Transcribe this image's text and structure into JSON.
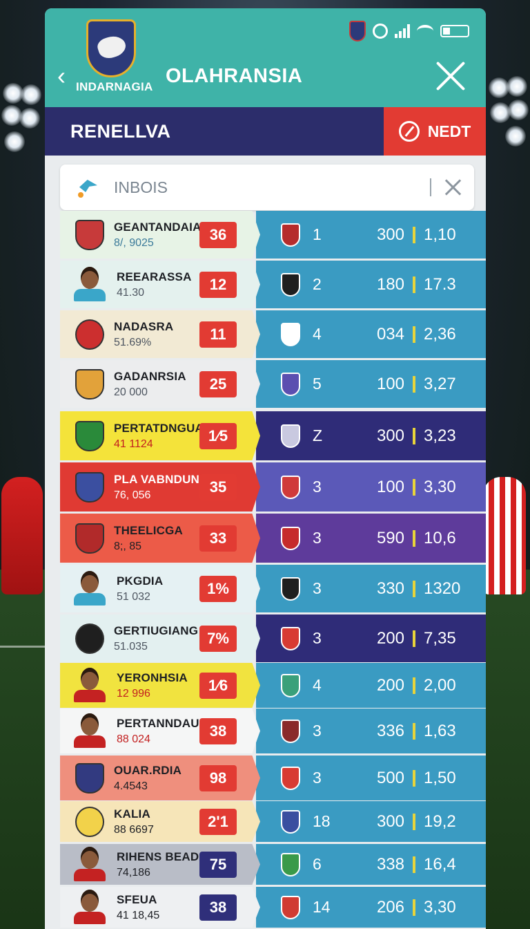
{
  "header": {
    "brand_sub": "INDARNAGIA",
    "title": "OLAHRANSIA"
  },
  "subbar": {
    "title": "RENELLVA",
    "next_label": "NEDT"
  },
  "search": {
    "placeholder": "INBOIS"
  },
  "colors": {
    "teal": "#3fb3a8",
    "navy": "#2c2d6b",
    "red": "#e23b33",
    "blue": "#3a9bc2",
    "yellow": "#f5e43a"
  },
  "rows": [
    {
      "name": "GEANTANDAIA",
      "sub": "8/, 9025",
      "badge": "36",
      "pos": "1",
      "pts": "300",
      "ratio": "1,10",
      "icon": "crest-icon"
    },
    {
      "name": "REEARASSA",
      "sub": "41.30",
      "badge": "12",
      "pos": "2",
      "pts": "180",
      "ratio": "17.3",
      "icon": "player-avatar"
    },
    {
      "name": "NADASRA",
      "sub": "51.69%",
      "badge": "11",
      "pos": "4",
      "pts": "034",
      "ratio": "2,36",
      "icon": "crest-icon"
    },
    {
      "name": "GADANRSIA",
      "sub": "20 000",
      "badge": "25",
      "pos": "5",
      "pts": "100",
      "ratio": "3,27",
      "icon": "crest-icon"
    },
    {
      "name": "PERTATDNGUA",
      "sub": "41 1124",
      "badge": "1⁄5",
      "pos": "Z",
      "pts": "300",
      "ratio": "3,23",
      "icon": "crest-icon"
    },
    {
      "name": "PLA VABNDUN",
      "sub": "76, 056",
      "badge": "35",
      "pos": "3",
      "pts": "100",
      "ratio": "3,30",
      "icon": "crest-icon"
    },
    {
      "name": "THEELICGA",
      "sub": "8;, 85",
      "badge": "33",
      "pos": "3",
      "pts": "590",
      "ratio": "10,6",
      "icon": "crest-icon"
    },
    {
      "name": "PKGDIA",
      "sub": "51 032",
      "badge": "1%",
      "pos": "3",
      "pts": "330",
      "ratio": "1320",
      "icon": "player-avatar"
    },
    {
      "name": "GERTIUGIANG",
      "sub": "51.035",
      "badge": "7%",
      "pos": "3",
      "pts": "200",
      "ratio": "7,35",
      "icon": "crest-icon"
    },
    {
      "name": "YERONHSIA",
      "sub": "12 996",
      "badge": "1⁄6",
      "pos": "4",
      "pts": "200",
      "ratio": "2,00",
      "icon": "player-avatar"
    },
    {
      "name": "PERTANNDAUK",
      "sub": "88 024",
      "badge": "38",
      "pos": "3",
      "pts": "336",
      "ratio": "1,63",
      "icon": "player-avatar"
    },
    {
      "name": "OUAR.RDIA",
      "sub": "4.4543",
      "badge": "98",
      "pos": "3",
      "pts": "500",
      "ratio": "1,50",
      "icon": "crest-icon"
    },
    {
      "name": "KALIA",
      "sub": "88 6697",
      "badge": "2'1",
      "pos": "18",
      "pts": "300",
      "ratio": "19,2",
      "icon": "crest-icon"
    },
    {
      "name": "RIHENS BEADA",
      "sub": "74,186",
      "badge": "75",
      "pos": "6",
      "pts": "338",
      "ratio": "16,4",
      "icon": "player-avatar"
    },
    {
      "name": "SFEUA",
      "sub": "41 18,45",
      "badge": "38",
      "pos": "14",
      "pts": "206",
      "ratio": "3,30",
      "icon": "player-avatar"
    }
  ]
}
